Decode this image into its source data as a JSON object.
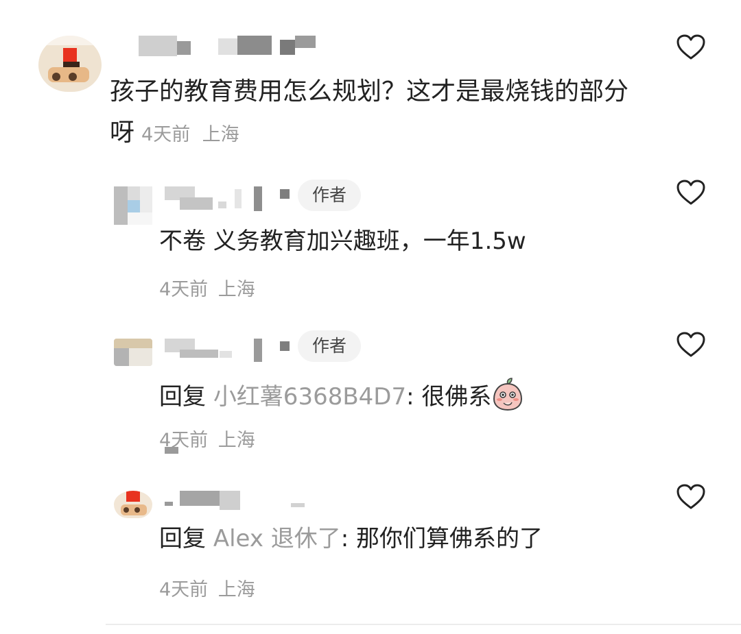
{
  "comments": [
    {
      "text": "孩子的教育费用怎么规划？这才是最烧钱的部分呀",
      "time": "4天前",
      "location": "上海",
      "like_icon": "heart-outline-icon"
    }
  ],
  "replies": [
    {
      "badge": "作者",
      "text": "不卷 义务教育加兴趣班，一年1.5w",
      "time": "4天前",
      "location": "上海",
      "like_icon": "heart-outline-icon"
    },
    {
      "badge": "作者",
      "reply_prefix": "回复",
      "reply_to": "小红薯6368B4D7",
      "text": ": 很佛系",
      "emoji": "blushing-peach-emoji",
      "time": "4天前",
      "location": "上海",
      "like_icon": "heart-outline-icon"
    },
    {
      "reply_prefix": "回复",
      "reply_to": "Alex 退休了",
      "text": ": 那你们算佛系的了",
      "time": "4天前",
      "location": "上海",
      "like_icon": "heart-outline-icon"
    }
  ],
  "colors": {
    "text": "#222222",
    "meta": "#9b9b9b",
    "badge_bg": "#f3f3f3",
    "divider": "#ececec"
  }
}
